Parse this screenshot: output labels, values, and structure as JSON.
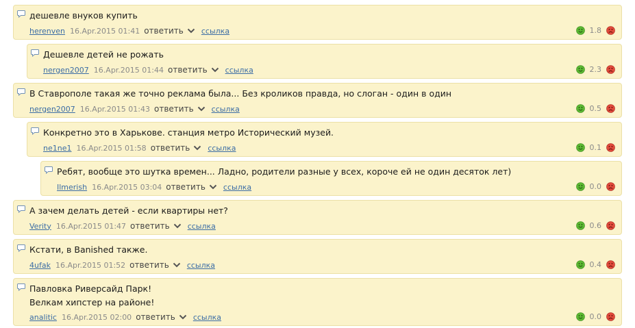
{
  "colors": {
    "comment_bg": "#fbf3cb",
    "comment_border": "#ebe0a6",
    "author_link": "#3a6ca5",
    "vote_up": "#5cb833",
    "vote_down": "#e04a3c"
  },
  "icons": {
    "comment": "speech-bubble-icon",
    "reply_expand": "chevron-down-icon",
    "vote_up": "green-smiley-icon",
    "vote_down": "red-sad-face-icon"
  },
  "comments": [
    {
      "text": "дешевле внуков купить",
      "author": "herenven",
      "date": "16.Apr.2015 01:41",
      "reply": "ответить",
      "link": "ссылка",
      "score": "1.8",
      "depth": 0
    },
    {
      "text": "Дешевле детей не рожать",
      "author": "nergen2007",
      "date": "16.Apr.2015 01:44",
      "reply": "ответить",
      "link": "ссылка",
      "score": "2.3",
      "depth": 1
    },
    {
      "text": "В Ставрополе такая же точно реклама была... Без кроликов правда, но слоган - один в один",
      "author": "nergen2007",
      "date": "16.Apr.2015 01:43",
      "reply": "ответить",
      "link": "ссылка",
      "score": "0.5",
      "depth": 0
    },
    {
      "text": "Конкретно это в Харькове. станция метро Исторический музей.",
      "author": "ne1ne1",
      "date": "16.Apr.2015 01:58",
      "reply": "ответить",
      "link": "ссылка",
      "score": "0.1",
      "depth": 1
    },
    {
      "text": "Ребят, вообще это шутка времен... Ладно, родители разные у всех, короче ей не один десяток лет)",
      "author": "Ilmerish",
      "date": "16.Apr.2015 03:04",
      "reply": "ответить",
      "link": "ссылка",
      "score": "0.0",
      "depth": 2
    },
    {
      "text": "А зачем делать детей - если квартиры нет?",
      "author": "Verity",
      "date": "16.Apr.2015 01:47",
      "reply": "ответить",
      "link": "ссылка",
      "score": "0.6",
      "depth": 0
    },
    {
      "text": "Кстати, в Banished также.",
      "author": "4ufak",
      "date": "16.Apr.2015 01:52",
      "reply": "ответить",
      "link": "ссылка",
      "score": "0.4",
      "depth": 0
    },
    {
      "text": "Павловка Риверсайд Парк!\nВелкам хипстер на районе!",
      "author": "analitic",
      "date": "16.Apr.2015 02:00",
      "reply": "ответить",
      "link": "ссылка",
      "score": "0.0",
      "depth": 0
    }
  ]
}
